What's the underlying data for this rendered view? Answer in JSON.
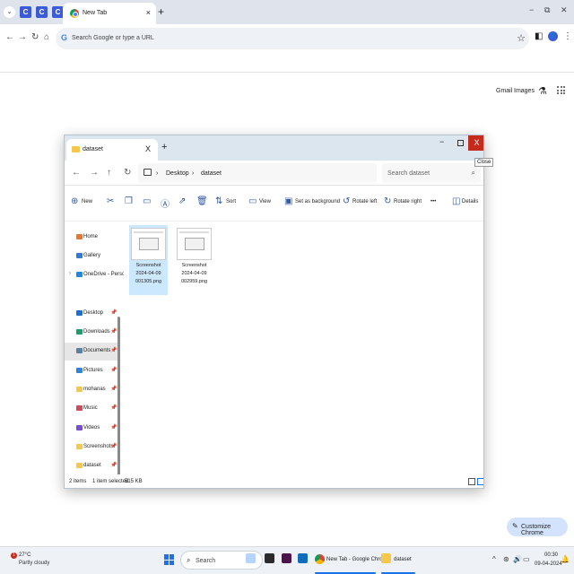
{
  "browser": {
    "tab_title": "New Tab",
    "tab_close": "×",
    "new_tab": "+",
    "pinned_tabs": [
      "C",
      "C",
      "C"
    ],
    "tab_list": "⌄",
    "omnibox_placeholder": "Search Google or type a URL",
    "omnibox_g": "G",
    "avatar_initial": "👤",
    "window_minimize": "−",
    "window_restore": "⧉",
    "window_close": "✕"
  },
  "ntp": {
    "gmail": "Gmail",
    "images": "Images",
    "customize_label": "Customize Chrome"
  },
  "explorer": {
    "tab_title": "dataset",
    "tab_close": "X",
    "new_tab": "+",
    "close_button": "X",
    "close_tooltip": "Close",
    "breadcrumb": [
      "Desktop",
      "dataset"
    ],
    "breadcrumb_sep": "›",
    "search_placeholder": "Search dataset",
    "commands": {
      "new": "New",
      "sort": "Sort",
      "view": "View",
      "set_background": "Set as background",
      "rotate_left": "Rotate left",
      "rotate_right": "Rotate right",
      "more": "•••",
      "details": "Details"
    },
    "nav_items": [
      {
        "label": "Home",
        "color": "#e8772e",
        "pinned": false
      },
      {
        "label": "Gallery",
        "color": "#2f7bd6",
        "pinned": false
      },
      {
        "label": "OneDrive - Persc",
        "color": "#1e88e5",
        "pinned": false
      },
      {
        "label": "Desktop",
        "color": "#1d6fcf",
        "pinned": true
      },
      {
        "label": "Downloads",
        "color": "#1b9d6e",
        "pinned": true
      },
      {
        "label": "Documents",
        "color": "#5b7fa6",
        "pinned": true
      },
      {
        "label": "Pictures",
        "color": "#2d86d9",
        "pinned": true
      },
      {
        "label": "mohanas",
        "color": "#f5c84c",
        "pinned": true
      },
      {
        "label": "Music",
        "color": "#d14b5a",
        "pinned": true
      },
      {
        "label": "Videos",
        "color": "#7b4bd1",
        "pinned": true
      },
      {
        "label": "Screenshots",
        "color": "#f5c84c",
        "pinned": true
      },
      {
        "label": "dataset",
        "color": "#f5c84c",
        "pinned": true
      }
    ],
    "selected_nav": "Documents",
    "files": [
      {
        "line1": "Screenshot",
        "line2": "2024-04-09",
        "line3": "001305.png",
        "selected": true
      },
      {
        "line1": "Screenshot",
        "line2": "2024-04-09",
        "line3": "002959.png",
        "selected": false
      }
    ],
    "status": {
      "count": "2 items",
      "selected": "1 item selected",
      "size": "515 KB"
    }
  },
  "taskbar": {
    "weather_badge": "1",
    "temperature": "27°C",
    "weather_desc": "Partly cloudy",
    "search": "Search",
    "chrome_label": "New Tab - Google Chro",
    "explorer_label": "dataset",
    "time": "00:30",
    "date": "09-04-2024"
  },
  "colors": {
    "accent": "#1a73e8",
    "explorer_close": "#c42b1c",
    "selection": "#cce8ff"
  }
}
